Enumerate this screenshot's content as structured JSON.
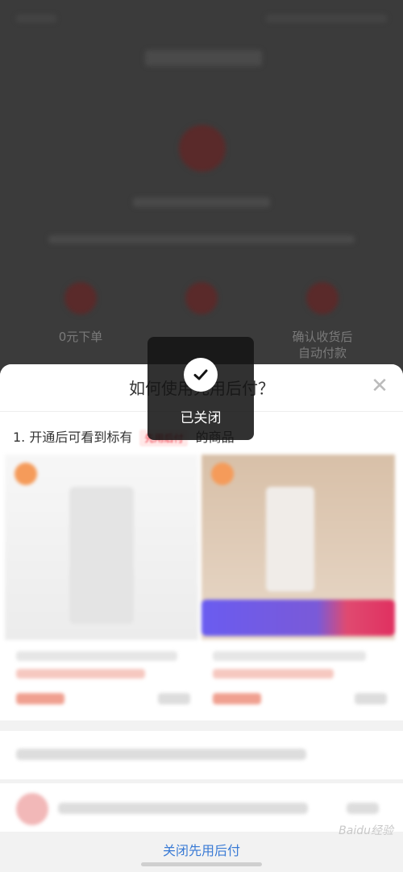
{
  "background": {
    "step_labels": [
      "0元下单",
      "",
      "确认收货后\n自动付款"
    ]
  },
  "sheet": {
    "title": "如何使用先用后付？",
    "close_icon": "close-icon",
    "step1_text_before": "1. 开通后可看到标有",
    "step1_tag": "先用后付",
    "step1_text_after": "的商品",
    "footer_link": "关闭先用后付",
    "watermark": "Baidu经验"
  },
  "toast": {
    "icon": "check-icon",
    "text": "已关闭"
  },
  "colors": {
    "accent": "#3a7bd5",
    "toast_bg": "#141414",
    "banner_left": "#6a5cf0",
    "banner_right": "#e03060"
  }
}
